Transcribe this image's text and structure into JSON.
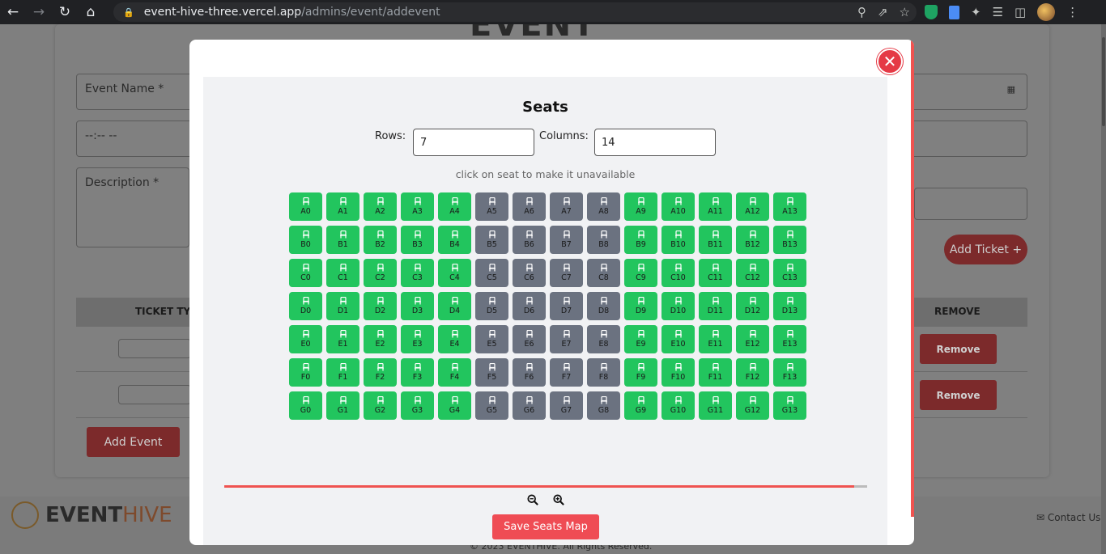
{
  "browser": {
    "url_host": "event-hive-three.vercel.app",
    "url_path": "/admins/event/addevent"
  },
  "background": {
    "event_name_placeholder": "Event Name *",
    "time_placeholder": "--:-- --",
    "description_placeholder": "Description *",
    "add_ticket_label": "Add Ticket",
    "ticket_type_header": "TICKET TYPE",
    "remove_header": "REMOVE",
    "remove_label": "Remove",
    "add_event_label": "Add Event",
    "footer_logo_event": "EVENT",
    "footer_logo_hive": "HIVE",
    "contact_label": "Contact Us",
    "copyright": "© 2023 EVENTHIVE. All Rights Reserved."
  },
  "modal": {
    "title": "Seats",
    "rows_label": "Rows:",
    "rows_value": "7",
    "columns_label": "Columns:",
    "columns_value": "14",
    "hint": "click on seat to make it unavailable",
    "save_label": "Save Seats Map",
    "progress_fraction": 0.98,
    "colors": {
      "available": "#22c55e",
      "unavailable": "#6b7280",
      "accent": "#ef4c54"
    }
  },
  "seats": {
    "row_letters": [
      "A",
      "B",
      "C",
      "D",
      "E",
      "F",
      "G"
    ],
    "columns": 14,
    "unavailable_columns": [
      5,
      6,
      7,
      8
    ]
  }
}
